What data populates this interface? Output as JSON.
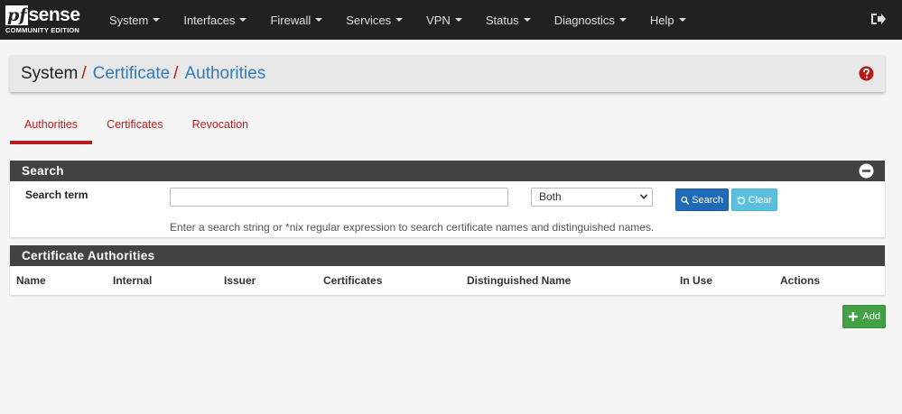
{
  "navbar": {
    "brand": {
      "pf": "pf",
      "sense": "sense",
      "edition": "COMMUNITY EDITION"
    },
    "menu": [
      "System",
      "Interfaces",
      "Firewall",
      "Services",
      "VPN",
      "Status",
      "Diagnostics",
      "Help"
    ],
    "logout_icon": "logout-icon"
  },
  "breadcrumb": {
    "items": [
      "System",
      "Certificate",
      "Authorities"
    ],
    "separator": "/",
    "help_icon": "question-circle-icon"
  },
  "tabs": [
    {
      "label": "Authorities",
      "active": true
    },
    {
      "label": "Certificates",
      "active": false
    },
    {
      "label": "Revocation",
      "active": false
    }
  ],
  "search_panel": {
    "title": "Search",
    "term_label": "Search term",
    "term_value": "",
    "scope_selected": "Both",
    "search_button": "Search",
    "clear_button": "Clear",
    "help_text": "Enter a search string or *nix regular expression to search certificate names and distinguished names."
  },
  "ca_panel": {
    "title": "Certificate Authorities",
    "columns": [
      "Name",
      "Internal",
      "Issuer",
      "Certificates",
      "Distinguished Name",
      "In Use",
      "Actions"
    ],
    "rows": []
  },
  "add_button": "Add",
  "colors": {
    "navbar": "#212121",
    "panel_heading": "#424242",
    "accent_red": "#b71c1c",
    "link_blue": "#337ab7",
    "search_btn": "#1e6ab8",
    "clear_btn": "#5bc0de",
    "add_btn": "#43a047"
  }
}
